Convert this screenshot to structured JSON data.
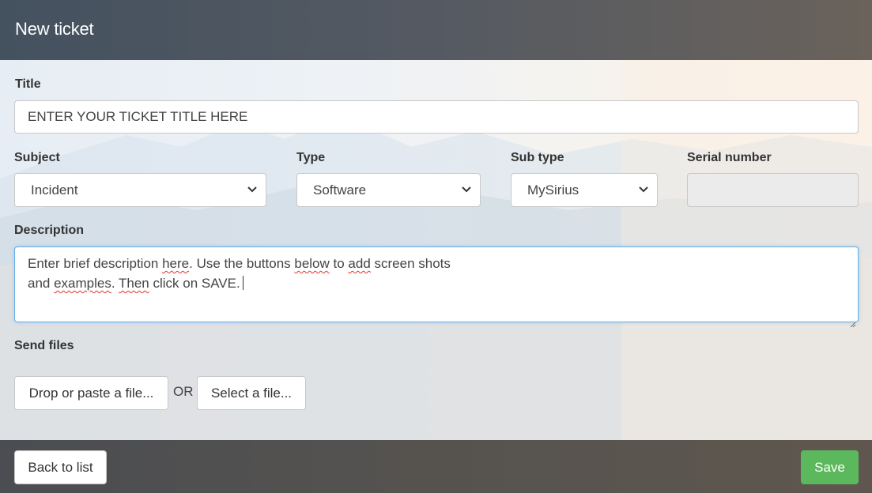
{
  "header": {
    "title": "New ticket"
  },
  "form": {
    "title_label": "Title",
    "title_value": "ENTER YOUR TICKET TITLE HERE",
    "subject_label": "Subject",
    "subject_value": "Incident",
    "type_label": "Type",
    "type_value": "Software",
    "subtype_label": "Sub type",
    "subtype_value": "MySirius",
    "serial_label": "Serial number",
    "serial_value": "",
    "description_label": "Description",
    "description_lines": [
      "Enter brief description here. Use the buttons below to add screen shots",
      "and examples. Then click on SAVE."
    ],
    "send_files_label": "Send files",
    "drop_button": "Drop or paste a file...",
    "or_text": "OR",
    "select_button": "Select a file..."
  },
  "footer": {
    "back_button": "Back to list",
    "save_button": "Save"
  },
  "colors": {
    "header_bg": "#4a5562",
    "save_green": "#5cb85c",
    "focus_blue": "#66afe9",
    "spell_red": "#e0322b"
  },
  "icons": [
    "chevron-down-icon",
    "resize-handle-icon"
  ]
}
